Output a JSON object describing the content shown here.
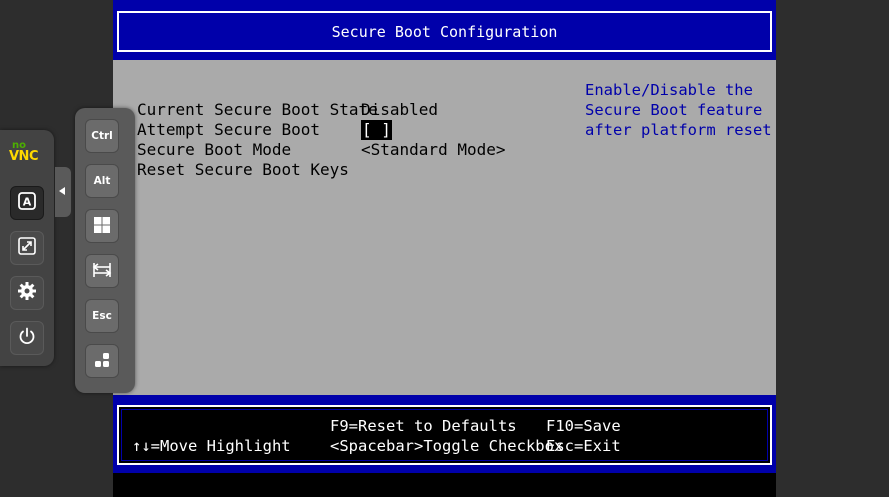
{
  "bios": {
    "title": "Secure Boot Configuration",
    "settings": [
      {
        "label": "Current Secure Boot State",
        "value": "Disabled"
      },
      {
        "label": "Attempt Secure Boot",
        "value": "[ ]"
      },
      {
        "label": "Secure Boot Mode",
        "value": "<Standard Mode>"
      },
      {
        "label": "Reset Secure Boot Keys",
        "value": ""
      }
    ],
    "help_text": "Enable/Disable the\nSecure Boot feature\nafter platform reset",
    "footer": {
      "f9": "F9=Reset to Defaults",
      "f10": "F10=Save",
      "move": "↑↓=Move Highlight",
      "toggle": "<Spacebar>Toggle Checkbox",
      "esc": "Esc=Exit"
    },
    "colors": {
      "blue": "#0000aa",
      "gray": "#aaaaaa",
      "black": "#000000",
      "white": "#ffffff"
    }
  },
  "novnc": {
    "logo_no": "no",
    "logo_vnc": "VNC",
    "buttons": [
      "keyboard-icon",
      "fullscreen-icon",
      "gear-icon",
      "power-icon"
    ],
    "extra_keys": {
      "ctrl": "Ctrl",
      "alt": "Alt",
      "windows": "windows-icon",
      "tab": "tab-icon",
      "esc": "Esc",
      "cad": "ctrl-alt-del-icon"
    }
  }
}
